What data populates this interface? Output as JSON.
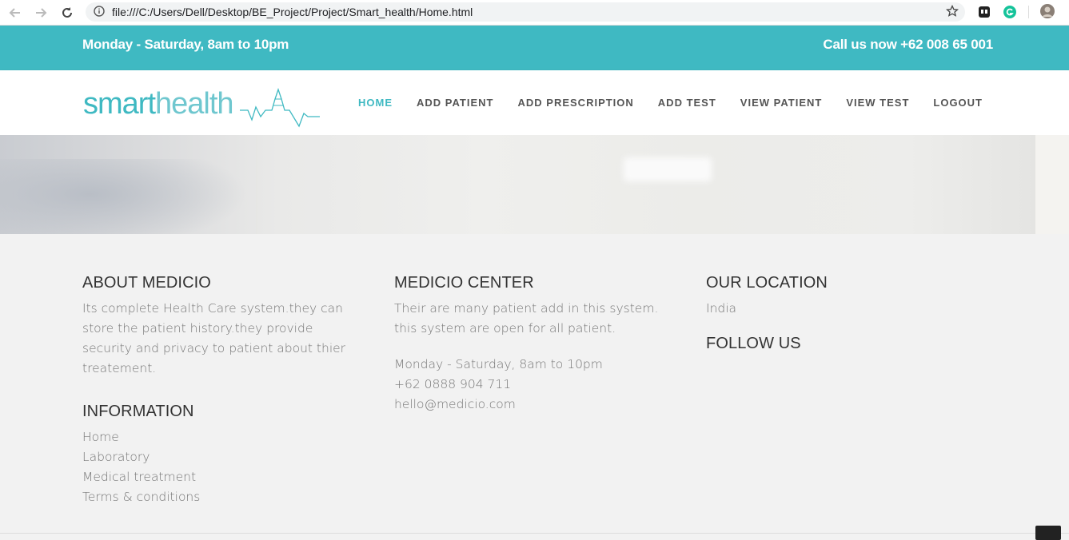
{
  "browser": {
    "url": "file:///C:/Users/Dell/Desktop/BE_Project/Project/Smart_health/Home.html",
    "icons": [
      "back-icon",
      "forward-icon",
      "reload-icon",
      "info-icon",
      "star-icon",
      "extension-icon",
      "grammarly-icon",
      "profile-avatar"
    ]
  },
  "topbar": {
    "hours": "Monday - Saturday, 8am to 10pm",
    "phone": "Call us now +62 008 65 001"
  },
  "logo": {
    "part1": "smart",
    "part2": "health"
  },
  "nav": {
    "items": [
      {
        "label": "HOME",
        "active": true
      },
      {
        "label": "ADD PATIENT"
      },
      {
        "label": "ADD PRESCRIPTION"
      },
      {
        "label": "ADD TEST"
      },
      {
        "label": "VIEW PATIENT"
      },
      {
        "label": "VIEW TEST"
      },
      {
        "label": "LOGOUT"
      }
    ]
  },
  "footer": {
    "about": {
      "title": "ABOUT MEDICIO",
      "text": "Its complete Health Care system.they can store the patient history.they provide security and privacy to patient about thier treatement."
    },
    "information": {
      "title": "INFORMATION",
      "links": [
        "Home",
        "Laboratory",
        "Medical treatment",
        "Terms & conditions"
      ]
    },
    "center": {
      "title": "MEDICIO CENTER",
      "text": "Their are many patient add in this system. this system are open for all patient.",
      "hours": "Monday - Saturday, 8am to 10pm",
      "phone": "+62 0888 904 711",
      "email": "hello@medicio.com"
    },
    "location": {
      "title": "OUR LOCATION",
      "text": "India"
    },
    "follow": {
      "title": "FOLLOW US"
    }
  },
  "colors": {
    "accent": "#3fb9c2",
    "text": "#777777",
    "heading": "#333333"
  }
}
